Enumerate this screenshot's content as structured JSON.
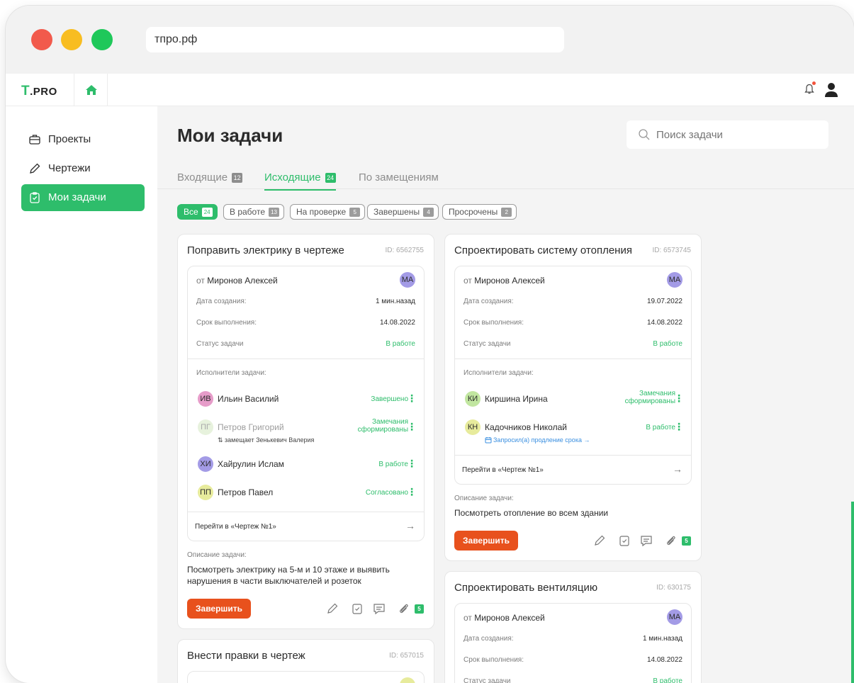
{
  "browser": {
    "url": "тпро.рф"
  },
  "app": {
    "logo_t": "T",
    "logo_rest": ".PRO"
  },
  "sidebar": {
    "items": [
      {
        "label": "Проекты"
      },
      {
        "label": "Чертежи"
      },
      {
        "label": "Мои задачи"
      }
    ]
  },
  "page": {
    "title": "Мои задачи",
    "search_placeholder": "Поиск задачи"
  },
  "tabs": [
    {
      "label": "Входящие",
      "count": "12"
    },
    {
      "label": "Исходящие",
      "count": "24"
    },
    {
      "label": "По замещениям"
    }
  ],
  "filters": [
    {
      "label": "Все",
      "count": "24"
    },
    {
      "label": "В работе",
      "count": "13"
    },
    {
      "label": "На проверке",
      "count": "5"
    },
    {
      "label": "Завершены",
      "count": "4"
    },
    {
      "label": "Просрочены",
      "count": "2"
    }
  ],
  "labels": {
    "created": "Дата создания:",
    "deadline": "Срок выполнения:",
    "status": "Статус задачи",
    "executors": "Исполнители задачи:",
    "description": "Описание задачи:",
    "finish": "Завершить",
    "arrow": "→"
  },
  "cards": [
    {
      "title": "Поправить электрику в чертеже",
      "id": "ID: 6562755",
      "from_prefix": "от",
      "from_name": "Миронов Алексей",
      "from_initials": "МА",
      "created": "1 мин.назад",
      "deadline": "14.08.2022",
      "status": "В работе",
      "executors": [
        {
          "initials": "ИВ",
          "name": "Ильин Василий",
          "status": "Завершено"
        },
        {
          "initials": "ПГ",
          "name": "Петров Григорий",
          "status_1": "Замечания",
          "status_2": "сформированы",
          "note": "⇅ замещает Зенькевич Валерия"
        },
        {
          "initials": "ХИ",
          "name": "Хайрулин Ислам",
          "status": "В работе"
        },
        {
          "initials": "ПП",
          "name": "Петров Павел",
          "status": "Согласовано"
        }
      ],
      "goto": "Перейти в «Чертеж №1»",
      "desc_1": "Посмотреть электрику на 5-м и 10 этаже и выявить",
      "desc_2": "нарушения в части выключателей и розеток",
      "attachments": "5"
    },
    {
      "title": "Спроектировать систему отопления",
      "id": "ID: 6573745",
      "from_prefix": "от",
      "from_name": "Миронов Алексей",
      "from_initials": "МА",
      "created": "19.07.2022",
      "deadline": "14.08.2022",
      "status": "В работе",
      "executors": [
        {
          "initials": "КИ",
          "name": "Киршина Ирина",
          "status_1": "Замечания",
          "status_2": "сформированы"
        },
        {
          "initials": "КН",
          "name": "Кадочников Николай",
          "status": "В работе",
          "link": "Запросил(а) продление срока →"
        }
      ],
      "goto": "Перейти в «Чертеж №1»",
      "desc_1": "Посмотреть отопление во всем здании",
      "attachments": "5"
    },
    {
      "title": "Спроектировать вентиляцию",
      "id": "ID: 630175",
      "from_prefix": "от",
      "from_name": "Миронов Алексей",
      "from_initials": "МА",
      "created": "1 мин.назад",
      "deadline": "14.08.2022",
      "status": "В работе"
    },
    {
      "title": "Внести правки в чертеж",
      "id": "ID: 657015"
    }
  ],
  "colors": {
    "accent": "#2ebd6b",
    "finish": "#e8511d",
    "link": "#3a8fe0"
  }
}
